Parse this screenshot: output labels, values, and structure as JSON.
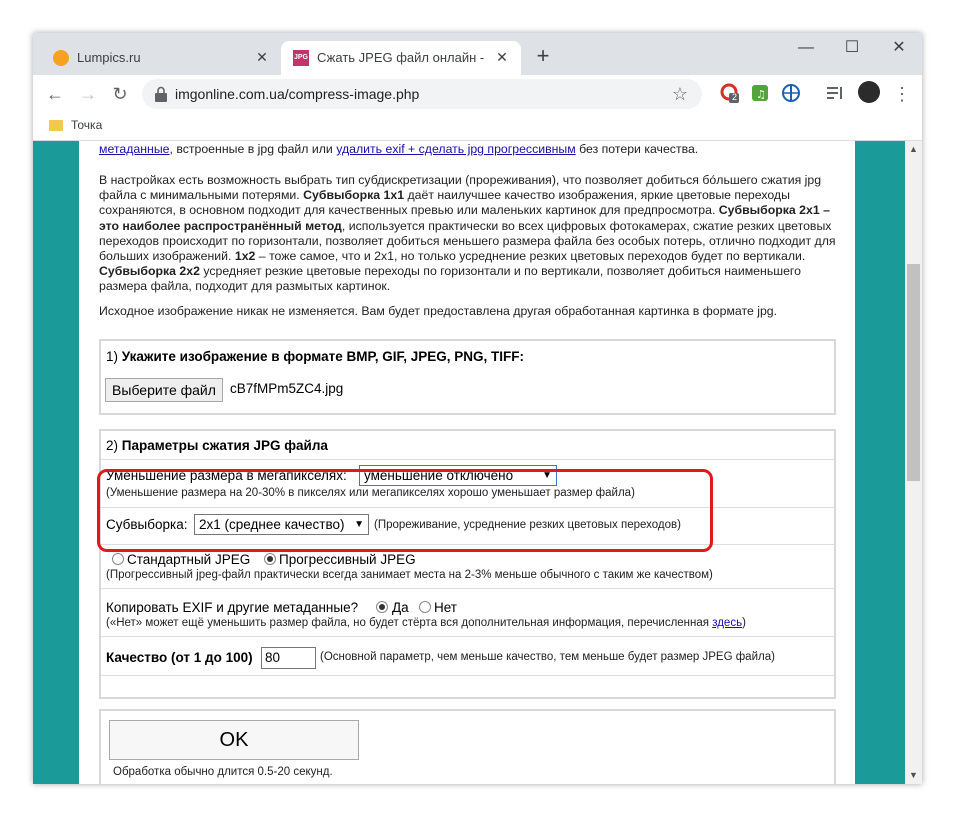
{
  "tabs": [
    {
      "label": "Lumpics.ru",
      "favicon": "lumpics-favicon"
    },
    {
      "label": "Сжать JPEG файл онлайн - IMG",
      "favicon_text": "JPG"
    }
  ],
  "toolbar": {
    "url": "imgonline.com.ua/compress-image.php",
    "ext_badge": "2"
  },
  "bookmarks": [
    {
      "label": "Точка"
    }
  ],
  "page": {
    "p1": {
      "link1": "метаданные",
      "t1": ", встроенные в jpg файл или ",
      "link2": "удалить exif + сделать jpg прогрессивным",
      "t2": " без потери качества."
    },
    "p2": {
      "t1": "В настройках есть возможность выбрать тип субдискретизации (прореживания), что позволяет добиться бо́льшего сжатия jpg файла с минимальными потерями. ",
      "b1": "Субвыборка 1x1",
      "t2": " даёт наилучшее качество изображения, яркие цветовые переходы сохраняются, в основном подходит для качественных превью или маленьких картинок для предпросмотра. ",
      "b2": "Субвыборка 2x1 – это наиболее распространённый метод",
      "t3": ", используется практически во всех цифровых фотокамерах, сжатие резких цветовых переходов происходит по горизонтали, позволяет добиться меньшего размера файла без особых потерь, отлично подходит для больших изображений. ",
      "b3": "1x2",
      "t4": " – тоже самое, что и 2x1, но только усреднение резких цветовых переходов будет по вертикали. ",
      "b4": "Субвыборка 2x2",
      "t5": " усредняет резкие цветовые переходы по горизонтали и по вертикали, позволяет добиться наименьшего размера файла, подходит для размытых картинок."
    },
    "p3": "Исходное изображение никак не изменяется. Вам будет предоставлена другая обработанная картинка в формате jpg.",
    "section1": {
      "num": "1) ",
      "title": "Укажите изображение в формате BMP, GIF, JPEG, PNG, TIFF:",
      "choose_button": "Выберите файл",
      "filename": "cB7fMPm5ZC4.jpg"
    },
    "section2": {
      "num": "2) ",
      "title": "Параметры сжатия JPG файла",
      "resize_label": "Уменьшение размера в мегапикселях:",
      "resize_value": "уменьшение отключено",
      "resize_note": "(Уменьшение размера на 20-30% в пикселях или мегапикселях хорошо уменьшает размер файла)",
      "subsampling_label": "Субвыборка:",
      "subsampling_value": "2x1 (среднее качество)",
      "subsampling_note": "(Прореживание, усреднение резких цветовых переходов)",
      "jpeg_standard": "Стандартный JPEG",
      "jpeg_progressive": "Прогрессивный JPEG",
      "jpeg_note": "(Прогрессивный jpeg-файл практически всегда занимает места на 2-3% меньше обычного с таким же качеством)",
      "exif_label": "Копировать EXIF и другие метаданные?",
      "exif_yes": "Да",
      "exif_no": "Нет",
      "exif_note": "(«Нет» может ещё уменьшить размер файла, но будет стёрта вся дополнительная информация, перечисленная ",
      "exif_link": "здесь",
      "exif_note_end": ")",
      "quality_label": "Качество (от 1 до 100)",
      "quality_value": "80",
      "quality_note": "(Основной параметр, чем меньше качество, тем меньше будет размер JPEG файла)"
    },
    "submit": {
      "ok_label": "OK",
      "note": "Обработка обычно длится 0.5-20 секунд."
    }
  }
}
